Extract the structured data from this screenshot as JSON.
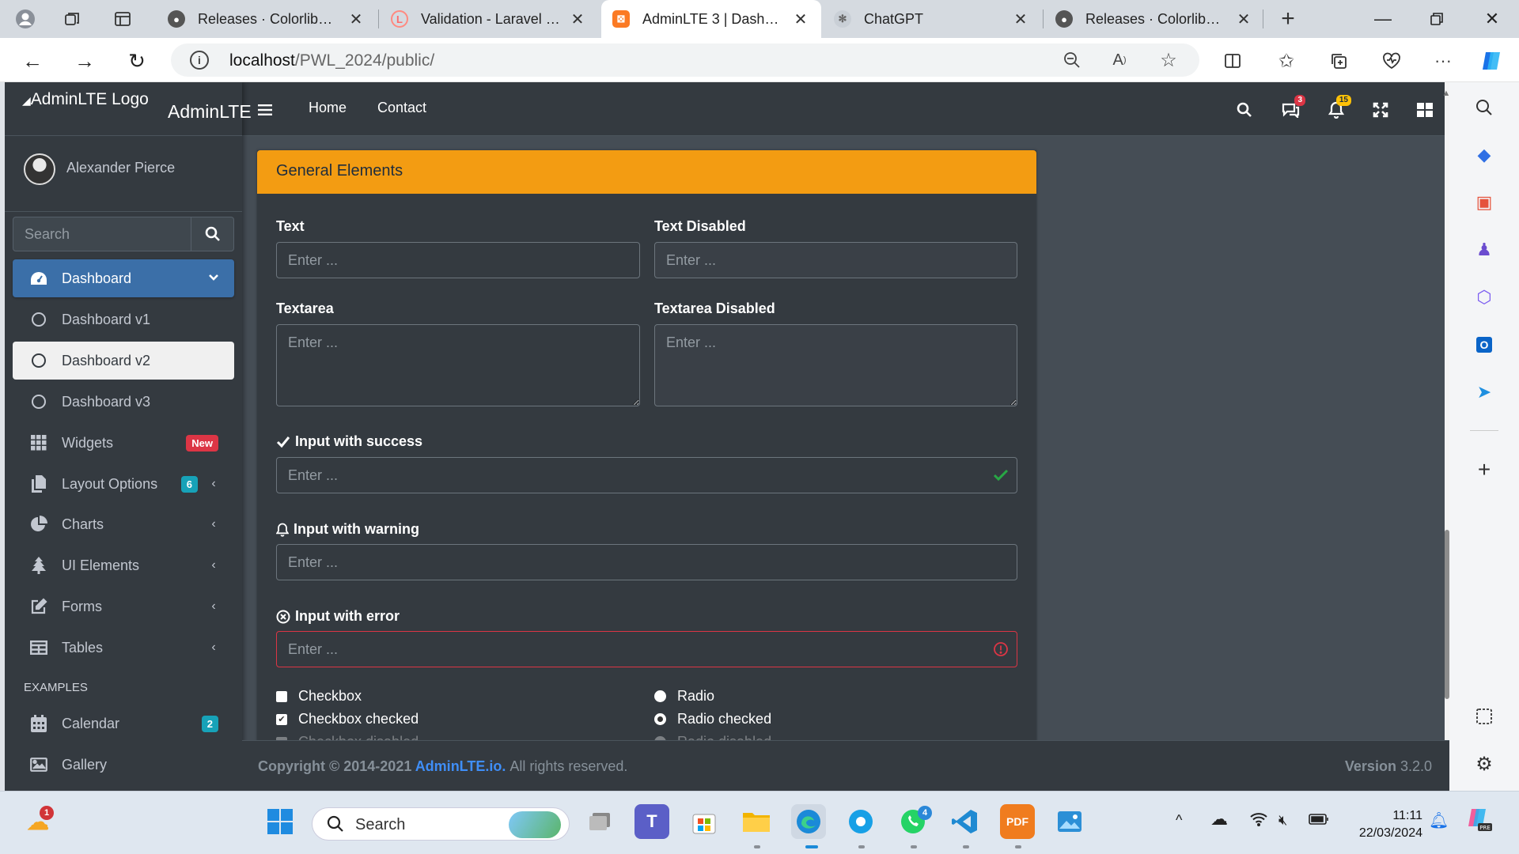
{
  "browser": {
    "tabs": [
      {
        "title": "Releases · ColorlibHQ/AdminLTE",
        "favicon": "github-icon"
      },
      {
        "title": "Validation - Laravel 10.x",
        "favicon": "laravel-icon"
      },
      {
        "title": "AdminLTE 3 | Dashboard",
        "favicon": "xampp-icon",
        "active": true
      },
      {
        "title": "ChatGPT",
        "favicon": "chatgpt-icon"
      },
      {
        "title": "Releases · ColorlibHQ/AdminLTE",
        "favicon": "github-icon"
      }
    ],
    "url_host": "localhost",
    "url_path": "/PWL_2024/public/"
  },
  "brand": {
    "logo_alt": "AdminLTE Logo",
    "text": "AdminLTE"
  },
  "user": {
    "name": "Alexander Pierce"
  },
  "sidebar": {
    "search_placeholder": "Search",
    "items": [
      {
        "label": "Dashboard",
        "icon": "tachometer-icon",
        "state": "active-parent"
      },
      {
        "label": "Dashboard v1",
        "icon": "circle-icon"
      },
      {
        "label": "Dashboard v2",
        "icon": "circle-icon",
        "state": "active-child"
      },
      {
        "label": "Dashboard v3",
        "icon": "circle-icon"
      },
      {
        "label": "Widgets",
        "icon": "th-icon",
        "badge": "New"
      },
      {
        "label": "Layout Options",
        "icon": "copy-icon",
        "badge": "6"
      },
      {
        "label": "Charts",
        "icon": "pie-chart-icon"
      },
      {
        "label": "UI Elements",
        "icon": "tree-icon"
      },
      {
        "label": "Forms",
        "icon": "edit-icon"
      },
      {
        "label": "Tables",
        "icon": "table-icon"
      }
    ],
    "header": "EXAMPLES",
    "examples": [
      {
        "label": "Calendar",
        "icon": "calendar-icon",
        "badge": "2"
      },
      {
        "label": "Gallery",
        "icon": "image-icon"
      }
    ]
  },
  "navbar": {
    "links": [
      "Home",
      "Contact"
    ],
    "messages_count": "3",
    "notifications_count": "15"
  },
  "card": {
    "title": "General Elements",
    "text_label": "Text",
    "text_disabled_label": "Text Disabled",
    "textarea_label": "Textarea",
    "textarea_disabled_label": "Textarea Disabled",
    "success_label": "Input with success",
    "warning_label": "Input with warning",
    "error_label": "Input with error",
    "placeholder": "Enter ...",
    "checkbox": "Checkbox",
    "checkbox_checked": "Checkbox checked",
    "checkbox_disabled": "Checkbox disabled",
    "radio": "Radio",
    "radio_checked": "Radio checked",
    "radio_disabled": "Radio disabled"
  },
  "footer": {
    "copyright_prefix": "Copyright © 2014-2021",
    "link": "AdminLTE.io.",
    "suffix": "All rights reserved.",
    "version_label": "Version",
    "version": "3.2.0"
  },
  "taskbar": {
    "search": "Search",
    "time": "11:11",
    "date": "22/03/2024",
    "weather_badge": "1",
    "whatsapp_badge": "4"
  },
  "colors": {
    "card_header": "#f39c12",
    "active_nav": "#3b6fa8",
    "success": "#28a745",
    "error": "#dc3545",
    "link": "#3f8ef7"
  }
}
